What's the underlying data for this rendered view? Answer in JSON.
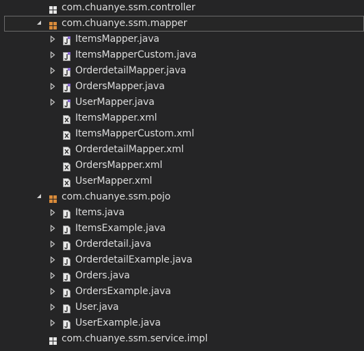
{
  "colors": {
    "background": "#252526",
    "text": "#dcdcdc",
    "package_icon_orange": "#d98b3a",
    "package_icon_white": "#e6e6e6",
    "java_file_icon": "#e8e8e8",
    "xml_file_icon": "#e8e8e8",
    "selection_border": "#6b6b6b"
  },
  "tree": {
    "packages": [
      {
        "label": "com.chuanye.ssm.controller",
        "icon": "package-empty-icon",
        "expanded": false,
        "children": []
      },
      {
        "label": "com.chuanye.ssm.mapper",
        "icon": "package-icon",
        "expanded": true,
        "selected": true,
        "children": [
          {
            "label": "ItemsMapper.java",
            "icon": "java-interface-icon",
            "expandable": true
          },
          {
            "label": "ItemsMapperCustom.java",
            "icon": "java-interface-icon",
            "expandable": true
          },
          {
            "label": "OrderdetailMapper.java",
            "icon": "java-interface-icon",
            "expandable": true
          },
          {
            "label": "OrdersMapper.java",
            "icon": "java-interface-icon",
            "expandable": true
          },
          {
            "label": "UserMapper.java",
            "icon": "java-interface-icon",
            "expandable": true
          },
          {
            "label": "ItemsMapper.xml",
            "icon": "xml-file-icon",
            "expandable": false
          },
          {
            "label": "ItemsMapperCustom.xml",
            "icon": "xml-file-icon",
            "expandable": false
          },
          {
            "label": "OrderdetailMapper.xml",
            "icon": "xml-file-icon",
            "expandable": false
          },
          {
            "label": "OrdersMapper.xml",
            "icon": "xml-file-icon",
            "expandable": false
          },
          {
            "label": "UserMapper.xml",
            "icon": "xml-file-icon",
            "expandable": false
          }
        ]
      },
      {
        "label": "com.chuanye.ssm.pojo",
        "icon": "package-icon",
        "expanded": true,
        "children": [
          {
            "label": "Items.java",
            "icon": "java-file-icon",
            "expandable": true
          },
          {
            "label": "ItemsExample.java",
            "icon": "java-file-icon",
            "expandable": true
          },
          {
            "label": "Orderdetail.java",
            "icon": "java-file-icon",
            "expandable": true
          },
          {
            "label": "OrderdetailExample.java",
            "icon": "java-file-icon",
            "expandable": true
          },
          {
            "label": "Orders.java",
            "icon": "java-file-icon",
            "expandable": true
          },
          {
            "label": "OrdersExample.java",
            "icon": "java-file-icon",
            "expandable": true
          },
          {
            "label": "User.java",
            "icon": "java-file-icon",
            "expandable": true
          },
          {
            "label": "UserExample.java",
            "icon": "java-file-icon",
            "expandable": true
          }
        ]
      },
      {
        "label": "com.chuanye.ssm.service.impl",
        "icon": "package-empty-icon",
        "expanded": false,
        "children": []
      }
    ]
  }
}
